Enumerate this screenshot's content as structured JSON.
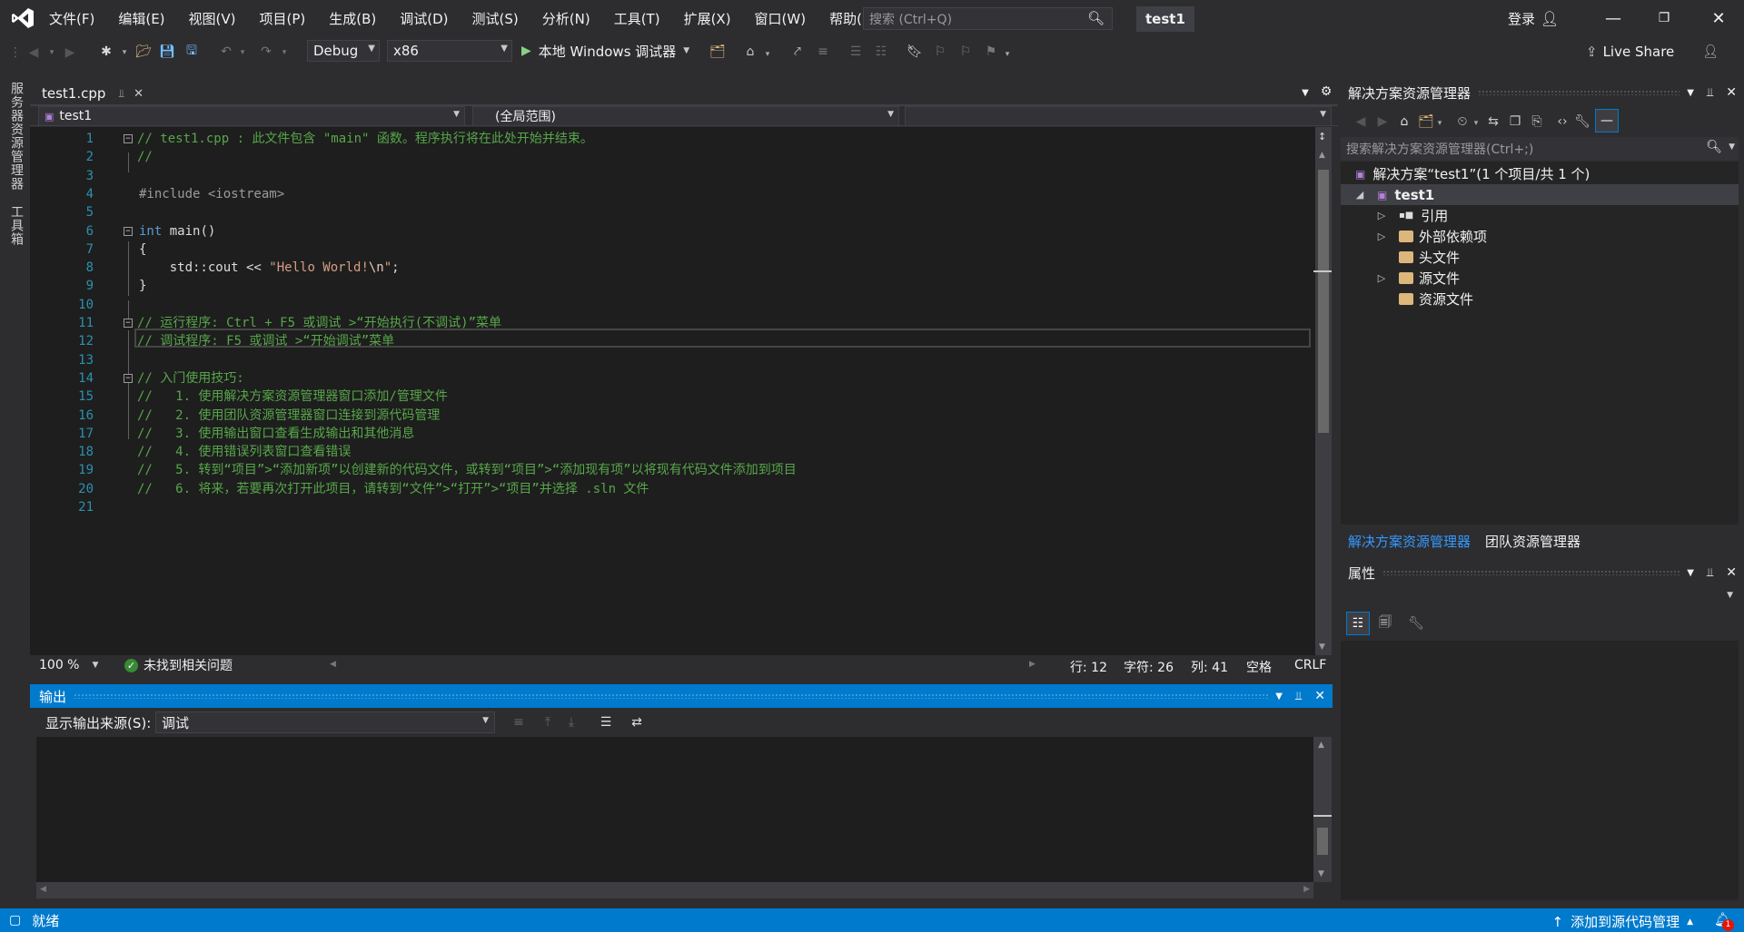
{
  "menu": [
    "文件(F)",
    "编辑(E)",
    "视图(V)",
    "项目(P)",
    "生成(B)",
    "调试(D)",
    "测试(S)",
    "分析(N)",
    "工具(T)",
    "扩展(X)",
    "窗口(W)",
    "帮助(H)"
  ],
  "search": {
    "placeholder": "搜索 (Ctrl+Q)"
  },
  "project_name": "test1",
  "login": "登录",
  "toolbar": {
    "config": "Debug",
    "platform": "x86",
    "run_label": "本地 Windows 调试器"
  },
  "live_share": "Live Share",
  "left_tabs": [
    "服务器资源管理器",
    "工具箱"
  ],
  "editor": {
    "tab_title": "test1.cpp",
    "nav_project": "test1",
    "nav_scope": "(全局范围)",
    "zoom": "100 %",
    "issues": "未找到相关问题",
    "line": "行: 12",
    "char": "字符: 26",
    "col": "列: 41",
    "space": "空格",
    "eol": "CRLF",
    "lines": [
      "// test1.cpp : 此文件包含 \"main\" 函数。程序执行将在此处开始并结束。",
      "//",
      "",
      "#include <iostream>",
      "",
      "int main()",
      "{",
      "    std::cout << \"Hello World!\\n\";",
      "}",
      "",
      "// 运行程序: Ctrl + F5 或调试 >“开始执行(不调试)”菜单",
      "// 调试程序: F5 或调试 >“开始调试”菜单",
      "",
      "// 入门使用技巧:",
      "//   1. 使用解决方案资源管理器窗口添加/管理文件",
      "//   2. 使用团队资源管理器窗口连接到源代码管理",
      "//   3. 使用输出窗口查看生成输出和其他消息",
      "//   4. 使用错误列表窗口查看错误",
      "//   5. 转到“项目”>“添加新项”以创建新的代码文件，或转到“项目”>“添加现有项”以将现有代码文件添加到项目",
      "//   6. 将来，若要再次打开此项目，请转到“文件”>“打开”>“项目”并选择 .sln 文件",
      ""
    ]
  },
  "output": {
    "title": "输出",
    "source_label": "显示输出来源(S):",
    "source_value": "调试"
  },
  "solution": {
    "title": "解决方案资源管理器",
    "search_placeholder": "搜索解决方案资源管理器(Ctrl+;)",
    "root": "解决方案“test1”(1 个项目/共 1 个)",
    "project": "test1",
    "items": [
      "引用",
      "外部依赖项",
      "头文件",
      "源文件",
      "资源文件"
    ],
    "tab_active": "解决方案资源管理器",
    "tab_other": "团队资源管理器"
  },
  "properties": {
    "title": "属性"
  },
  "status": {
    "ready": "就绪",
    "source_control": "添加到源代码管理",
    "notifications": "1"
  }
}
